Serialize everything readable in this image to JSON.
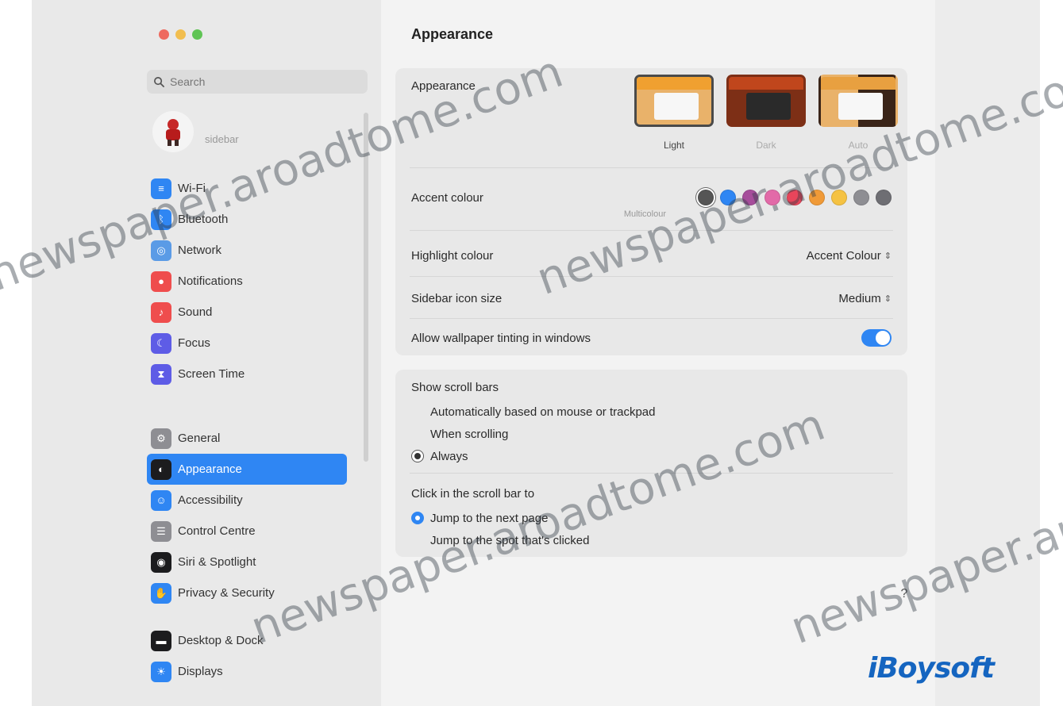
{
  "window_title": "Appearance",
  "search": {
    "placeholder": "Search"
  },
  "user": {
    "name": "sidebar"
  },
  "sidebar": {
    "group1": [
      {
        "label": "Wi-Fi",
        "icon": "wifi-icon",
        "color": "#2f86f3"
      },
      {
        "label": "Bluetooth",
        "icon": "bluetooth-icon",
        "color": "#2f86f3"
      },
      {
        "label": "Network",
        "icon": "network-icon",
        "color": "#5a9be6"
      },
      {
        "label": "Notifications",
        "icon": "bell-icon",
        "color": "#ef4d4d"
      },
      {
        "label": "Sound",
        "icon": "speaker-icon",
        "color": "#ef4d4d"
      },
      {
        "label": "Focus",
        "icon": "moon-icon",
        "color": "#5e5ce6"
      },
      {
        "label": "Screen Time",
        "icon": "hourglass-icon",
        "color": "#5e5ce6"
      }
    ],
    "group2": [
      {
        "label": "General",
        "icon": "gear-icon",
        "color": "#8e8e93"
      },
      {
        "label": "Appearance",
        "icon": "appearance-icon",
        "color": "#1c1c1e",
        "active": true
      },
      {
        "label": "Accessibility",
        "icon": "accessibility-icon",
        "color": "#2f86f3"
      },
      {
        "label": "Control Centre",
        "icon": "control-centre-icon",
        "color": "#8e8e93"
      },
      {
        "label": "Siri & Spotlight",
        "icon": "siri-icon",
        "color": "#1c1c1e"
      },
      {
        "label": "Privacy & Security",
        "icon": "hand-icon",
        "color": "#2f86f3"
      }
    ],
    "group3": [
      {
        "label": "Desktop & Dock",
        "icon": "dock-icon",
        "color": "#1c1c1e"
      },
      {
        "label": "Displays",
        "icon": "display-icon",
        "color": "#2f86f3"
      }
    ]
  },
  "appearance": {
    "label": "Appearance",
    "options": [
      {
        "label": "Light",
        "selected": true
      },
      {
        "label": "Dark",
        "selected": false
      },
      {
        "label": "Auto",
        "selected": false
      }
    ]
  },
  "accent": {
    "label": "Accent colour",
    "sub": "Multicolour",
    "colors": [
      "#555555",
      "#2f86f3",
      "#a64d9b",
      "#e26aa8",
      "#e8455b",
      "#f09a37",
      "#f5c242",
      "#8e8e93",
      "#6e6e73"
    ]
  },
  "highlight": {
    "label": "Highlight colour",
    "value": "Accent Colour"
  },
  "sidebar_icon": {
    "label": "Sidebar icon size",
    "value": "Medium"
  },
  "tinting": {
    "label": "Allow wallpaper tinting in windows",
    "on": true
  },
  "scroll_bars": {
    "title": "Show scroll bars",
    "options": [
      {
        "label": "Automatically based on mouse or trackpad",
        "checked": false
      },
      {
        "label": "When scrolling",
        "checked": false
      },
      {
        "label": "Always",
        "checked": true
      }
    ]
  },
  "click_scroll": {
    "title": "Click in the scroll bar to",
    "options": [
      {
        "label": "Jump to the next page",
        "checked": true
      },
      {
        "label": "Jump to the spot that's clicked",
        "checked": false
      }
    ]
  },
  "help": "?",
  "logo": "iBoysoft",
  "watermark": "newspaper.aroadtome.com"
}
